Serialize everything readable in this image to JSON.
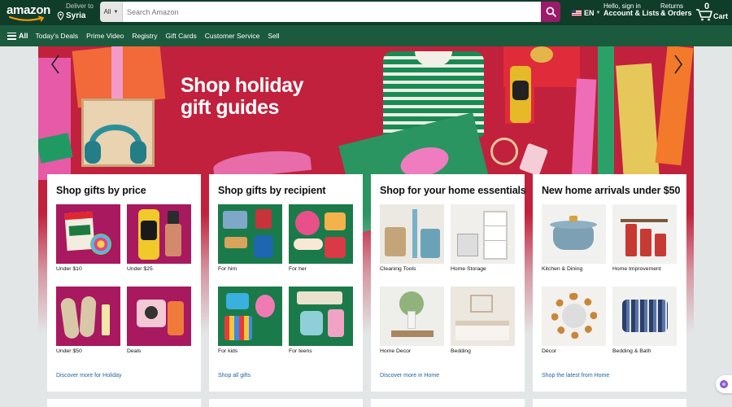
{
  "header": {
    "logo_text": "amazon",
    "deliver_label": "Deliver to",
    "deliver_location": "Syria",
    "search_category": "All",
    "search_placeholder": "Search Amazon",
    "language": "EN",
    "account_greeting": "Hello, sign in",
    "account_label": "Account & Lists",
    "returns_label": "Returns",
    "orders_label": "& Orders",
    "cart_count": "0",
    "cart_label": "Cart"
  },
  "subnav": {
    "all_label": "All",
    "links": [
      "Today's Deals",
      "Prime Video",
      "Registry",
      "Gift Cards",
      "Customer Service",
      "Sell"
    ]
  },
  "hero": {
    "title_line1": "Shop holiday",
    "title_line2": "gift guides"
  },
  "cards": [
    {
      "title": "Shop gifts by price",
      "tiles": [
        "Under $10",
        "Under $25",
        "Under $50",
        "Deals"
      ],
      "link": "Discover more for Holiday"
    },
    {
      "title": "Shop gifts by recipient",
      "tiles": [
        "For him",
        "For her",
        "For kids",
        "For teens"
      ],
      "link": "Shop all gifts"
    },
    {
      "title": "Shop for your home essentials",
      "tiles": [
        "Cleaning Tools",
        "Home Storage",
        "Home Decor",
        "Bedding"
      ],
      "link": "Discover more in Home"
    },
    {
      "title": "New home arrivals under $50",
      "tiles": [
        "Kitchen & Dining",
        "Home Improvement",
        "Décor",
        "Bedding & Bath"
      ],
      "link": "Shop the latest from Home"
    }
  ],
  "colors": {
    "nav_top": "#0f3d2a",
    "nav_sub": "#1c5a3e",
    "search_button": "#9b1a6a",
    "hero_red": "#c1213c",
    "link_blue": "#2162a1",
    "tile_magenta": "#a8195f",
    "tile_green": "#1b7a4a"
  },
  "icons": [
    "location-pin-icon",
    "search-icon",
    "us-flag-icon",
    "cart-icon",
    "menu-icon",
    "chevron-left-icon",
    "chevron-right-icon",
    "help-icon"
  ]
}
